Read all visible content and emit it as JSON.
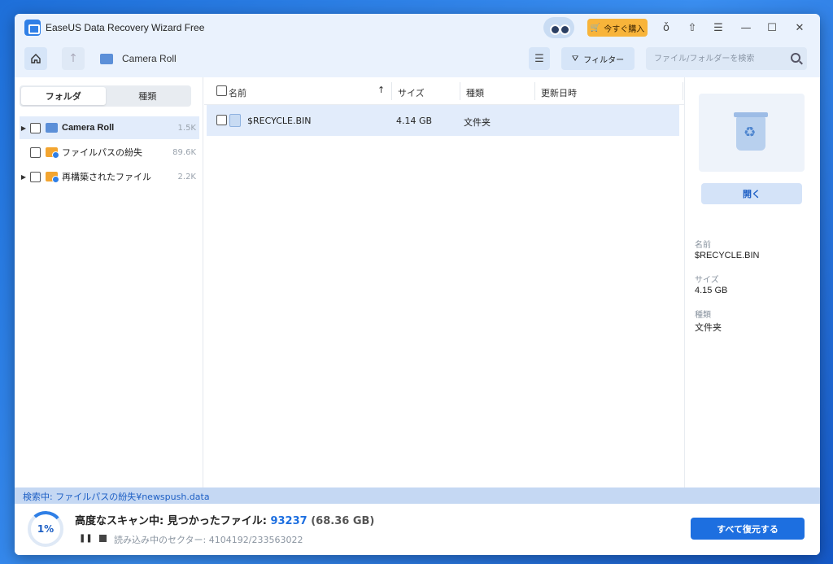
{
  "app": {
    "title": "EaseUS Data Recovery Wizard Free",
    "buy_label": "今すぐ購入"
  },
  "toolbar": {
    "breadcrumb": "Camera Roll",
    "filter_label": "フィルター",
    "search_placeholder": "ファイル/フォルダーを検索"
  },
  "sidebar": {
    "tabs": [
      "フォルダ",
      "種類"
    ],
    "items": [
      {
        "label": "Camera Roll",
        "count": "1.5K"
      },
      {
        "label": "ファイルパスの紛失",
        "count": "89.6K"
      },
      {
        "label": "再構築されたファイル",
        "count": "2.2K"
      }
    ]
  },
  "file_list": {
    "columns": [
      "名前",
      "サイズ",
      "種類",
      "更新日時"
    ],
    "rows": [
      {
        "name": "$RECYCLE.BIN",
        "size": "4.14 GB",
        "type": "文件夹",
        "modified": ""
      }
    ]
  },
  "details": {
    "open_label": "開く",
    "name_label": "名前",
    "name_value": "$RECYCLE.BIN",
    "size_label": "サイズ",
    "size_value": "4.15 GB",
    "type_label": "種類",
    "type_value": "文件夹"
  },
  "status": {
    "searching": "検索中: ファイルパスの紛失¥newspush.data",
    "progress": "1%",
    "progress_fraction": 0.01,
    "scan_title": "高度なスキャン中: 見つかったファイル:",
    "found_count": "93237",
    "found_size": "(68.36 GB)",
    "sector_text": "読み込み中のセクター: 4104192/233563022",
    "recover_all_label": "すべて復元する"
  },
  "colors": {
    "accent": "#1d6fe0",
    "buy": "#f8b43a",
    "selected_row": "#e2ecfb"
  }
}
